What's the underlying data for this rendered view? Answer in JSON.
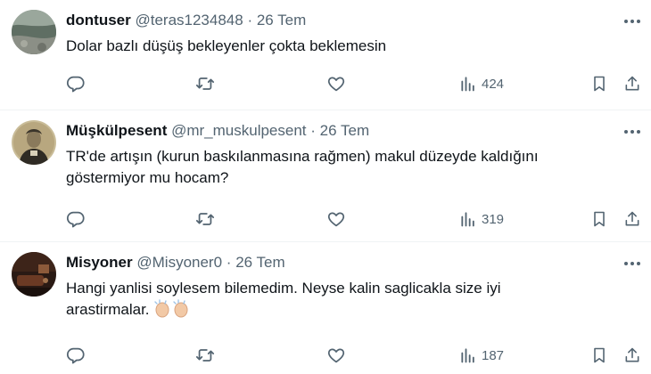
{
  "tweets": [
    {
      "name": "dontuser",
      "handle": "@teras1234848",
      "separator": "·",
      "date": "26 Tem",
      "text_lines": [
        "Dolar bazlı düşüş bekleyenler çokta beklemesin"
      ],
      "views": "424",
      "avatar": "avatar-landscape"
    },
    {
      "name": "Müşkülpesent",
      "handle": "@mr_muskulpesent",
      "separator": "·",
      "date": "26 Tem",
      "text_lines": [
        "TR'de artışın (kurun baskılanmasına rağmen) makul düzeyde kaldığını",
        "göstermiyor mu hocam?"
      ],
      "views": "319",
      "avatar": "avatar-portrait"
    },
    {
      "name": "Misyoner",
      "handle": "@Misyoner0",
      "separator": "·",
      "date": "26 Tem",
      "text_lines": [
        "Hangi yanlisi soylesem bilemedim. Neyse kalin saglicakla size iyi",
        "arastirmalar."
      ],
      "emoji": "clapping-hands-emoji",
      "views": "187",
      "avatar": "avatar-dark-room"
    }
  ],
  "icons": {
    "reply": "reply-icon",
    "retweet": "retweet-icon",
    "like": "heart-icon",
    "views": "views-chart-icon",
    "bookmark": "bookmark-icon",
    "share": "share-upload-icon",
    "more": "more-dots-icon"
  },
  "colors": {
    "text": "#0f1419",
    "secondary": "#536471",
    "divider": "#eff3f4",
    "background": "#ffffff"
  }
}
